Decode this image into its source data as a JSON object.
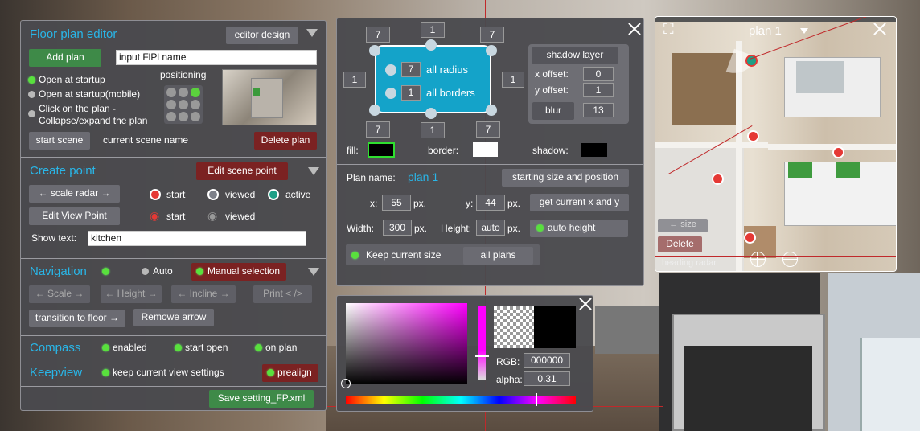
{
  "colors": {
    "accent": "#29b6e8",
    "green": "#3e8a48",
    "red_btn": "#7b2222",
    "panel": "#4a4a4e"
  },
  "left": {
    "title": "Floor plan editor",
    "editor_design": "editor design",
    "add_plan": "Add plan",
    "plan_name_input": "input FlPl name",
    "positioning": "positioning",
    "open_startup": "Open at startup",
    "open_startup_mobile": "Open at startup(mobile)",
    "click_collapse_1": "Click on the plan -",
    "click_collapse_2": "Collapse/expand the plan",
    "start_scene": "start scene",
    "current_scene": "current scene name",
    "delete_plan": "Delete plan",
    "create_point": "Create point",
    "edit_scene_point": "Edit scene point",
    "scale_radar": "← scale radar →",
    "start": "start",
    "viewed": "viewed",
    "active": "active",
    "edit_view_point": "Edit View Point",
    "start2": "start",
    "viewed2": "viewed",
    "show_text_label": "Show text:",
    "show_text_value": "kitchen",
    "navigation": "Navigation",
    "auto": "Auto",
    "manual_selection": "Manual selection",
    "scale": "← Scale →",
    "height": "← Height →",
    "incline": "← Incline →",
    "print": "Print < />",
    "transition": "transition to floor →",
    "remove_arrow": "Remowe arrow",
    "compass": "Compass",
    "enabled": "enabled",
    "start_open": "start open",
    "on_plan": "on plan",
    "keepview": "Keepview",
    "keep_current": "keep current view settings",
    "prealign": "prealign",
    "save": "Save setting_FP.xml"
  },
  "middle": {
    "num_top_left": "7",
    "num_top_center": "1",
    "num_top_right": "7",
    "num_left": "1",
    "num_right": "1",
    "num_bottom_left": "7",
    "num_bottom_center": "1",
    "num_bottom_right": "7",
    "radius_value": "7",
    "all_radius": "all radius",
    "borders_value": "1",
    "all_borders": "all borders",
    "shadow_layer": "shadow layer",
    "x_offset": "x offset:",
    "x_offset_value": "0",
    "y_offset": "y offset:",
    "y_offset_value": "1",
    "blur": "blur",
    "blur_value": "13",
    "fill": "fill:",
    "border": "border:",
    "shadow": "shadow:",
    "plan_name_label": "Plan name:",
    "plan_name_value": "plan 1",
    "starting_size": "starting size and position",
    "x_label": "x:",
    "x_value": "55",
    "px1": "px.",
    "y_label": "y:",
    "y_value": "44",
    "px2": "px.",
    "get_current": "get current x and y",
    "width_label": "Width:",
    "width_value": "300",
    "px3": "px.",
    "height_label": "Height:",
    "height_value": "auto",
    "px4": "px.",
    "auto_height": "auto height",
    "keep_size": "Keep current size",
    "all_plans": "all plans"
  },
  "picker": {
    "rgb_label": "RGB:",
    "rgb_value": "000000",
    "alpha_label": "alpha:",
    "alpha_value": "0.31"
  },
  "preview": {
    "title": "plan 1",
    "size": "← size",
    "delete": "Delete",
    "heading_radar": "heading radar"
  }
}
